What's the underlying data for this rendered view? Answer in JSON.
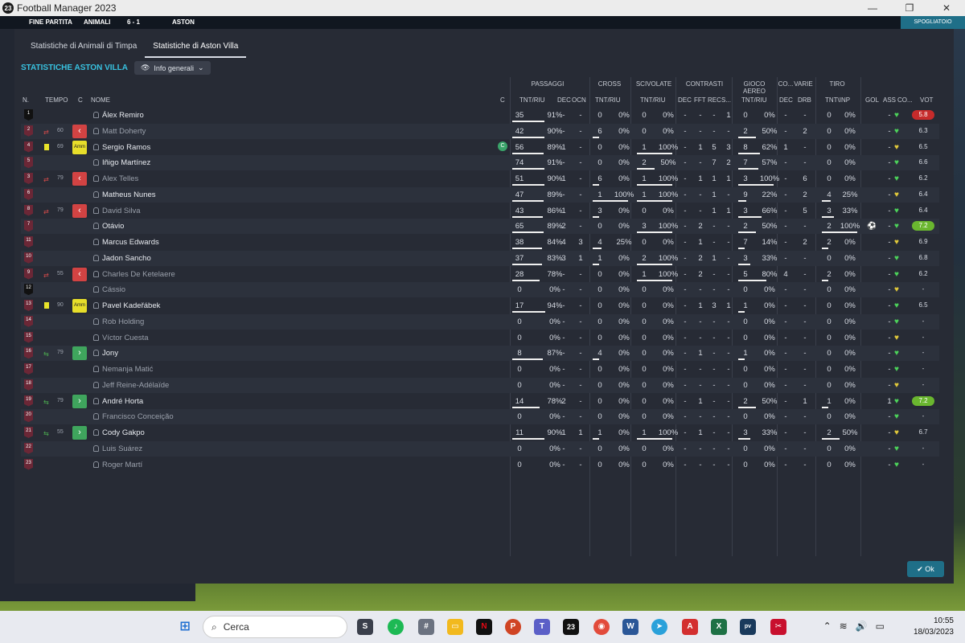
{
  "window": {
    "title": "Football Manager 2023",
    "app_icon_label": "23"
  },
  "game_header": {
    "status": "FINE PARTITA",
    "home": "ANIMALI",
    "score": "6 - 1",
    "away": "ASTON",
    "right_label": "SPOGLIATOIO"
  },
  "tabs": [
    {
      "label": "Statistiche di Animali di Timpa"
    },
    {
      "label": "Statistiche di Aston Villa",
      "active": true
    }
  ],
  "section": {
    "title": "STATISTICHE ASTON VILLA",
    "view_dropdown": "Info generali"
  },
  "groups": [
    "PASSAGGI",
    "CROSS",
    "SCIVOLATE",
    "CONTRASTI",
    "GIOCO AEREO",
    "CO...",
    "VARIE",
    "TIRO"
  ],
  "columns": {
    "n": "N.",
    "tempo": "TEMPO",
    "c": "C",
    "nome": "NOME",
    "c2": "C",
    "tnt_riu": "TNT/RIU",
    "dec": "DEC",
    "ocn": "OCN",
    "fft": "FFT",
    "rec": "REC",
    "s": "S...",
    "drb": "DRB",
    "tnt_inp": "TNT\\INP",
    "gol": "GOL",
    "ass": "ASS",
    "co": "CO...",
    "vot": "VOT"
  },
  "players": [
    {
      "n": "1",
      "gk": true,
      "name": "Álex Remiro",
      "pas": [
        "35",
        "91%"
      ],
      "pdec": "-",
      "pocn": "-",
      "cr": [
        "0",
        "0%"
      ],
      "sc": [
        "0",
        "0%"
      ],
      "cdec": "-",
      "cfft": "-",
      "crec": "-",
      "cs": "1",
      "ga": [
        "0",
        "0%"
      ],
      "co": "-",
      "drb": "-",
      "ti": [
        "0",
        "0%"
      ],
      "gol": "",
      "ass": "-",
      "vot": "5.8",
      "vc": "red"
    },
    {
      "n": "2",
      "sub": "out",
      "min": "60",
      "cb": "out",
      "dim": true,
      "name": "Matt Doherty",
      "pas": [
        "42",
        "90%"
      ],
      "pdec": "-",
      "pocn": "-",
      "cr": [
        "6",
        "0%"
      ],
      "sc": [
        "0",
        "0%"
      ],
      "cdec": "-",
      "cfft": "-",
      "crec": "-",
      "cs": "-",
      "ga": [
        "2",
        "50%"
      ],
      "co": "-",
      "drb": "2",
      "ti": [
        "0",
        "0%"
      ],
      "gol": "",
      "ass": "-",
      "vot": "6.3"
    },
    {
      "n": "4",
      "yc": true,
      "min": "69",
      "cb": "amm",
      "name": "Sergio Ramos",
      "cap": true,
      "pas": [
        "56",
        "89%"
      ],
      "pdec": "1",
      "pocn": "-",
      "cr": [
        "0",
        "0%"
      ],
      "sc": [
        "1",
        "100%"
      ],
      "cdec": "-",
      "cfft": "1",
      "crec": "5",
      "cs": "3",
      "ga": [
        "8",
        "62%"
      ],
      "co": "1",
      "drb": "-",
      "ti": [
        "0",
        "0%"
      ],
      "gol": "",
      "ass": "-",
      "vot": "6.5"
    },
    {
      "n": "5",
      "name": "Iñigo Martínez",
      "pas": [
        "74",
        "91%"
      ],
      "pdec": "-",
      "pocn": "-",
      "cr": [
        "0",
        "0%"
      ],
      "sc": [
        "2",
        "50%"
      ],
      "cdec": "-",
      "cfft": "-",
      "crec": "7",
      "cs": "2",
      "ga": [
        "7",
        "57%"
      ],
      "co": "-",
      "drb": "-",
      "ti": [
        "0",
        "0%"
      ],
      "gol": "",
      "ass": "-",
      "vot": "6.6"
    },
    {
      "n": "3",
      "sub": "out",
      "min": "79",
      "cb": "out",
      "dim": true,
      "name": "Alex Telles",
      "pas": [
        "51",
        "90%"
      ],
      "pdec": "1",
      "pocn": "-",
      "cr": [
        "6",
        "0%"
      ],
      "sc": [
        "1",
        "100%"
      ],
      "cdec": "-",
      "cfft": "1",
      "crec": "1",
      "cs": "1",
      "ga": [
        "3",
        "100%"
      ],
      "co": "-",
      "drb": "6",
      "ti": [
        "0",
        "0%"
      ],
      "gol": "",
      "ass": "-",
      "vot": "6.2"
    },
    {
      "n": "6",
      "name": "Matheus Nunes",
      "pas": [
        "47",
        "89%"
      ],
      "pdec": "-",
      "pocn": "-",
      "cr": [
        "1",
        "100%"
      ],
      "sc": [
        "1",
        "100%"
      ],
      "cdec": "-",
      "cfft": "-",
      "crec": "1",
      "cs": "-",
      "ga": [
        "9",
        "22%"
      ],
      "co": "-",
      "drb": "2",
      "ti": [
        "4",
        "25%"
      ],
      "gol": "",
      "ass": "-",
      "vot": "6.4"
    },
    {
      "n": "8",
      "sub": "out",
      "min": "79",
      "cb": "out",
      "dim": true,
      "name": "David Silva",
      "pas": [
        "43",
        "86%"
      ],
      "pdec": "1",
      "pocn": "-",
      "cr": [
        "3",
        "0%"
      ],
      "sc": [
        "0",
        "0%"
      ],
      "cdec": "-",
      "cfft": "-",
      "crec": "1",
      "cs": "1",
      "ga": [
        "3",
        "66%"
      ],
      "co": "-",
      "drb": "5",
      "ti": [
        "3",
        "33%"
      ],
      "gol": "",
      "ass": "-",
      "vot": "6.4"
    },
    {
      "n": "7",
      "name": "Otávio",
      "pas": [
        "65",
        "89%"
      ],
      "pdec": "2",
      "pocn": "-",
      "cr": [
        "0",
        "0%"
      ],
      "sc": [
        "3",
        "100%"
      ],
      "cdec": "-",
      "cfft": "2",
      "crec": "-",
      "cs": "-",
      "ga": [
        "2",
        "50%"
      ],
      "co": "-",
      "drb": "-",
      "ti": [
        "2",
        "100%"
      ],
      "gol": "⚽",
      "ass": "-",
      "vot": "7.2",
      "vc": "green"
    },
    {
      "n": "11",
      "name": "Marcus Edwards",
      "pas": [
        "38",
        "84%"
      ],
      "pdec": "4",
      "pocn": "3",
      "cr": [
        "4",
        "25%"
      ],
      "sc": [
        "0",
        "0%"
      ],
      "cdec": "-",
      "cfft": "1",
      "crec": "-",
      "cs": "-",
      "ga": [
        "7",
        "14%"
      ],
      "co": "-",
      "drb": "2",
      "ti": [
        "2",
        "0%"
      ],
      "gol": "",
      "ass": "-",
      "vot": "6.9"
    },
    {
      "n": "10",
      "name": "Jadon Sancho",
      "pas": [
        "37",
        "83%"
      ],
      "pdec": "3",
      "pocn": "1",
      "cr": [
        "1",
        "0%"
      ],
      "sc": [
        "2",
        "100%"
      ],
      "cdec": "-",
      "cfft": "2",
      "crec": "1",
      "cs": "-",
      "ga": [
        "3",
        "33%"
      ],
      "co": "-",
      "drb": "-",
      "ti": [
        "0",
        "0%"
      ],
      "gol": "",
      "ass": "-",
      "vot": "6.8"
    },
    {
      "n": "9",
      "sub": "out",
      "min": "55",
      "cb": "out",
      "dim": true,
      "name": "Charles De Ketelaere",
      "pas": [
        "28",
        "78%"
      ],
      "pdec": "-",
      "pocn": "-",
      "cr": [
        "0",
        "0%"
      ],
      "sc": [
        "1",
        "100%"
      ],
      "cdec": "-",
      "cfft": "2",
      "crec": "-",
      "cs": "-",
      "ga": [
        "5",
        "80%"
      ],
      "co": "4",
      "drb": "-",
      "ti": [
        "2",
        "0%"
      ],
      "gol": "",
      "ass": "-",
      "vot": "6.2"
    },
    {
      "n": "12",
      "gk": true,
      "dim": true,
      "name": "Cássio",
      "pas": [
        "0",
        "0%"
      ],
      "pdec": "-",
      "pocn": "-",
      "cr": [
        "0",
        "0%"
      ],
      "sc": [
        "0",
        "0%"
      ],
      "cdec": "-",
      "cfft": "-",
      "crec": "-",
      "cs": "-",
      "ga": [
        "0",
        "0%"
      ],
      "co": "-",
      "drb": "-",
      "ti": [
        "0",
        "0%"
      ],
      "gol": "",
      "ass": "-",
      "vot": "-"
    },
    {
      "n": "13",
      "yc": true,
      "min": "90",
      "cb": "amm",
      "name": "Pavel Kadeřábek",
      "pas": [
        "17",
        "94%"
      ],
      "pdec": "-",
      "pocn": "-",
      "cr": [
        "0",
        "0%"
      ],
      "sc": [
        "0",
        "0%"
      ],
      "cdec": "-",
      "cfft": "1",
      "crec": "3",
      "cs": "1",
      "ga": [
        "1",
        "0%"
      ],
      "co": "-",
      "drb": "-",
      "ti": [
        "0",
        "0%"
      ],
      "gol": "",
      "ass": "-",
      "vot": "6.5"
    },
    {
      "n": "14",
      "dim": true,
      "name": "Rob Holding",
      "pas": [
        "0",
        "0%"
      ],
      "pdec": "-",
      "pocn": "-",
      "cr": [
        "0",
        "0%"
      ],
      "sc": [
        "0",
        "0%"
      ],
      "cdec": "-",
      "cfft": "-",
      "crec": "-",
      "cs": "-",
      "ga": [
        "0",
        "0%"
      ],
      "co": "-",
      "drb": "-",
      "ti": [
        "0",
        "0%"
      ],
      "gol": "",
      "ass": "-",
      "vot": "-"
    },
    {
      "n": "15",
      "dim": true,
      "name": "Víctor Cuesta",
      "pas": [
        "0",
        "0%"
      ],
      "pdec": "-",
      "pocn": "-",
      "cr": [
        "0",
        "0%"
      ],
      "sc": [
        "0",
        "0%"
      ],
      "cdec": "-",
      "cfft": "-",
      "crec": "-",
      "cs": "-",
      "ga": [
        "0",
        "0%"
      ],
      "co": "-",
      "drb": "-",
      "ti": [
        "0",
        "0%"
      ],
      "gol": "",
      "ass": "-",
      "vot": "-"
    },
    {
      "n": "16",
      "sub": "in",
      "min": "79",
      "cb": "in",
      "name": "Jony",
      "pas": [
        "8",
        "87%"
      ],
      "pdec": "-",
      "pocn": "-",
      "cr": [
        "4",
        "0%"
      ],
      "sc": [
        "0",
        "0%"
      ],
      "cdec": "-",
      "cfft": "1",
      "crec": "-",
      "cs": "-",
      "ga": [
        "1",
        "0%"
      ],
      "co": "-",
      "drb": "-",
      "ti": [
        "0",
        "0%"
      ],
      "gol": "",
      "ass": "-",
      "vot": "-"
    },
    {
      "n": "17",
      "dim": true,
      "name": "Nemanja Matić",
      "pas": [
        "0",
        "0%"
      ],
      "pdec": "-",
      "pocn": "-",
      "cr": [
        "0",
        "0%"
      ],
      "sc": [
        "0",
        "0%"
      ],
      "cdec": "-",
      "cfft": "-",
      "crec": "-",
      "cs": "-",
      "ga": [
        "0",
        "0%"
      ],
      "co": "-",
      "drb": "-",
      "ti": [
        "0",
        "0%"
      ],
      "gol": "",
      "ass": "-",
      "vot": "-"
    },
    {
      "n": "18",
      "dim": true,
      "name": "Jeff Reine-Adélaïde",
      "pas": [
        "0",
        "0%"
      ],
      "pdec": "-",
      "pocn": "-",
      "cr": [
        "0",
        "0%"
      ],
      "sc": [
        "0",
        "0%"
      ],
      "cdec": "-",
      "cfft": "-",
      "crec": "-",
      "cs": "-",
      "ga": [
        "0",
        "0%"
      ],
      "co": "-",
      "drb": "-",
      "ti": [
        "0",
        "0%"
      ],
      "gol": "",
      "ass": "-",
      "vot": "-"
    },
    {
      "n": "19",
      "sub": "in",
      "min": "79",
      "cb": "in",
      "name": "André Horta",
      "pas": [
        "14",
        "78%"
      ],
      "pdec": "2",
      "pocn": "-",
      "cr": [
        "0",
        "0%"
      ],
      "sc": [
        "0",
        "0%"
      ],
      "cdec": "-",
      "cfft": "1",
      "crec": "-",
      "cs": "-",
      "ga": [
        "2",
        "50%"
      ],
      "co": "-",
      "drb": "1",
      "ti": [
        "1",
        "0%"
      ],
      "gol": "",
      "ass": "1",
      "vot": "7.2",
      "vc": "green"
    },
    {
      "n": "20",
      "dim": true,
      "name": "Francisco Conceição",
      "pas": [
        "0",
        "0%"
      ],
      "pdec": "-",
      "pocn": "-",
      "cr": [
        "0",
        "0%"
      ],
      "sc": [
        "0",
        "0%"
      ],
      "cdec": "-",
      "cfft": "-",
      "crec": "-",
      "cs": "-",
      "ga": [
        "0",
        "0%"
      ],
      "co": "-",
      "drb": "-",
      "ti": [
        "0",
        "0%"
      ],
      "gol": "",
      "ass": "-",
      "vot": "-"
    },
    {
      "n": "21",
      "sub": "in",
      "min": "55",
      "cb": "in",
      "name": "Cody Gakpo",
      "pas": [
        "11",
        "90%"
      ],
      "pdec": "1",
      "pocn": "1",
      "cr": [
        "1",
        "0%"
      ],
      "sc": [
        "1",
        "100%"
      ],
      "cdec": "-",
      "cfft": "1",
      "crec": "-",
      "cs": "-",
      "ga": [
        "3",
        "33%"
      ],
      "co": "-",
      "drb": "-",
      "ti": [
        "2",
        "50%"
      ],
      "gol": "",
      "ass": "-",
      "vot": "6.7"
    },
    {
      "n": "22",
      "dim": true,
      "name": "Luis Suárez",
      "pas": [
        "0",
        "0%"
      ],
      "pdec": "-",
      "pocn": "-",
      "cr": [
        "0",
        "0%"
      ],
      "sc": [
        "0",
        "0%"
      ],
      "cdec": "-",
      "cfft": "-",
      "crec": "-",
      "cs": "-",
      "ga": [
        "0",
        "0%"
      ],
      "co": "-",
      "drb": "-",
      "ti": [
        "0",
        "0%"
      ],
      "gol": "",
      "ass": "-",
      "vot": "-"
    },
    {
      "n": "23",
      "dim": true,
      "name": "Roger Martí",
      "pas": [
        "0",
        "0%"
      ],
      "pdec": "-",
      "pocn": "-",
      "cr": [
        "0",
        "0%"
      ],
      "sc": [
        "0",
        "0%"
      ],
      "cdec": "-",
      "cfft": "-",
      "crec": "-",
      "cs": "-",
      "ga": [
        "0",
        "0%"
      ],
      "co": "-",
      "drb": "-",
      "ti": [
        "0",
        "0%"
      ],
      "gol": "",
      "ass": "-",
      "vot": "-"
    }
  ],
  "ok_button": "Ok",
  "taskbar": {
    "search": "Cerca",
    "time": "10:55",
    "date": "18/03/2023"
  }
}
